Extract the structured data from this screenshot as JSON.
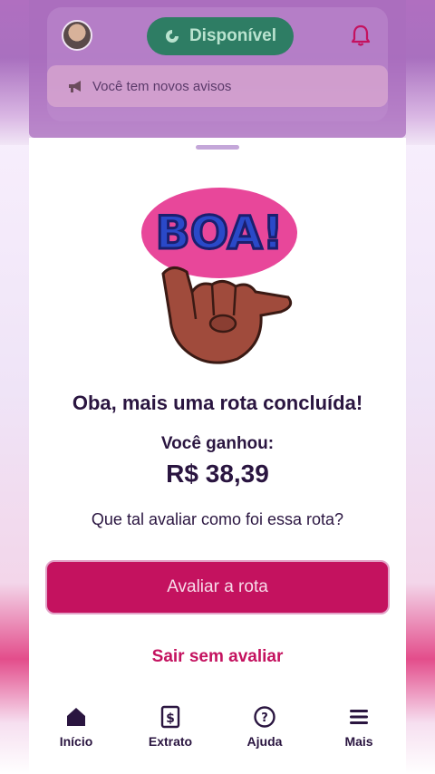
{
  "header": {
    "status": "Disponível",
    "notice": "Você tem novos avisos"
  },
  "main": {
    "sticker_text": "BOA!",
    "title": "Oba, mais uma rota concluída!",
    "earned_label": "Você ganhou:",
    "earned_value": "R$ 38,39",
    "question": "Que tal avaliar como foi essa rota?",
    "rate_button": "Avaliar a rota",
    "skip_link": "Sair sem avaliar"
  },
  "nav": {
    "items": [
      {
        "label": "Início",
        "icon": "home-icon"
      },
      {
        "label": "Extrato",
        "icon": "statement-icon"
      },
      {
        "label": "Ajuda",
        "icon": "help-icon"
      },
      {
        "label": "Mais",
        "icon": "menu-icon"
      }
    ]
  },
  "colors": {
    "primary": "#c4125f",
    "status_green": "#2e7d64",
    "text_dark": "#2a1540"
  }
}
